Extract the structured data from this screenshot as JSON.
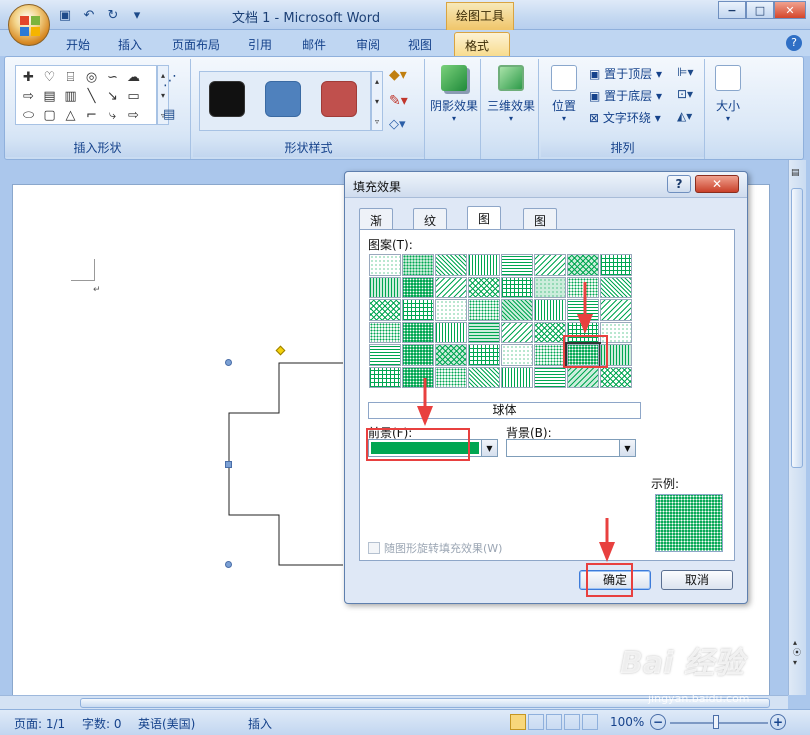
{
  "window": {
    "title": "文档 1 - Microsoft Word",
    "context_tab_title": "绘图工具",
    "minimize": "−",
    "maximize": "□",
    "close": "✕",
    "help": "?"
  },
  "tabs": [
    "开始",
    "插入",
    "页面布局",
    "引用",
    "邮件",
    "审阅",
    "视图",
    "格式"
  ],
  "active_tab": "格式",
  "ribbon": {
    "group_insert_shapes": "插入形状",
    "group_shape_styles": "形状样式",
    "group_shadow": "阴影效果",
    "group_3d": "三维效果",
    "group_arrange": "排列",
    "group_size": "大小",
    "btn_position": "位置",
    "btn_bring_front": "置于顶层",
    "btn_send_back": "置于底层",
    "btn_text_wrap": "文字环绕",
    "btn_size": "大小",
    "style_swatches": [
      "#111111",
      "#4f81bd",
      "#c0504d"
    ]
  },
  "dialog": {
    "title": "填充效果",
    "tabs": [
      "渐变",
      "纹理",
      "图案",
      "图片"
    ],
    "active_tab": "图案",
    "pattern_label": "图案(T):",
    "pattern_name": "球体",
    "foreground_label": "前景(F):",
    "background_label": "背景(B):",
    "foreground_color": "#00a651",
    "background_color": "#ffffff",
    "sample_label": "示例:",
    "rotate_label": "随图形旋转填充效果(W)",
    "rotate_checked": false,
    "ok": "确定",
    "cancel": "取消",
    "selected_pattern": {
      "row": 5,
      "col": 7
    }
  },
  "statusbar": {
    "page": "页面: 1/1",
    "words": "字数: 0",
    "language": "英语(美国)",
    "mode": "插入",
    "zoom": "100%"
  },
  "annotation_color": "#e8403f",
  "watermark": {
    "text": "Bai 经验",
    "url": "jingyan.baidu.com"
  }
}
